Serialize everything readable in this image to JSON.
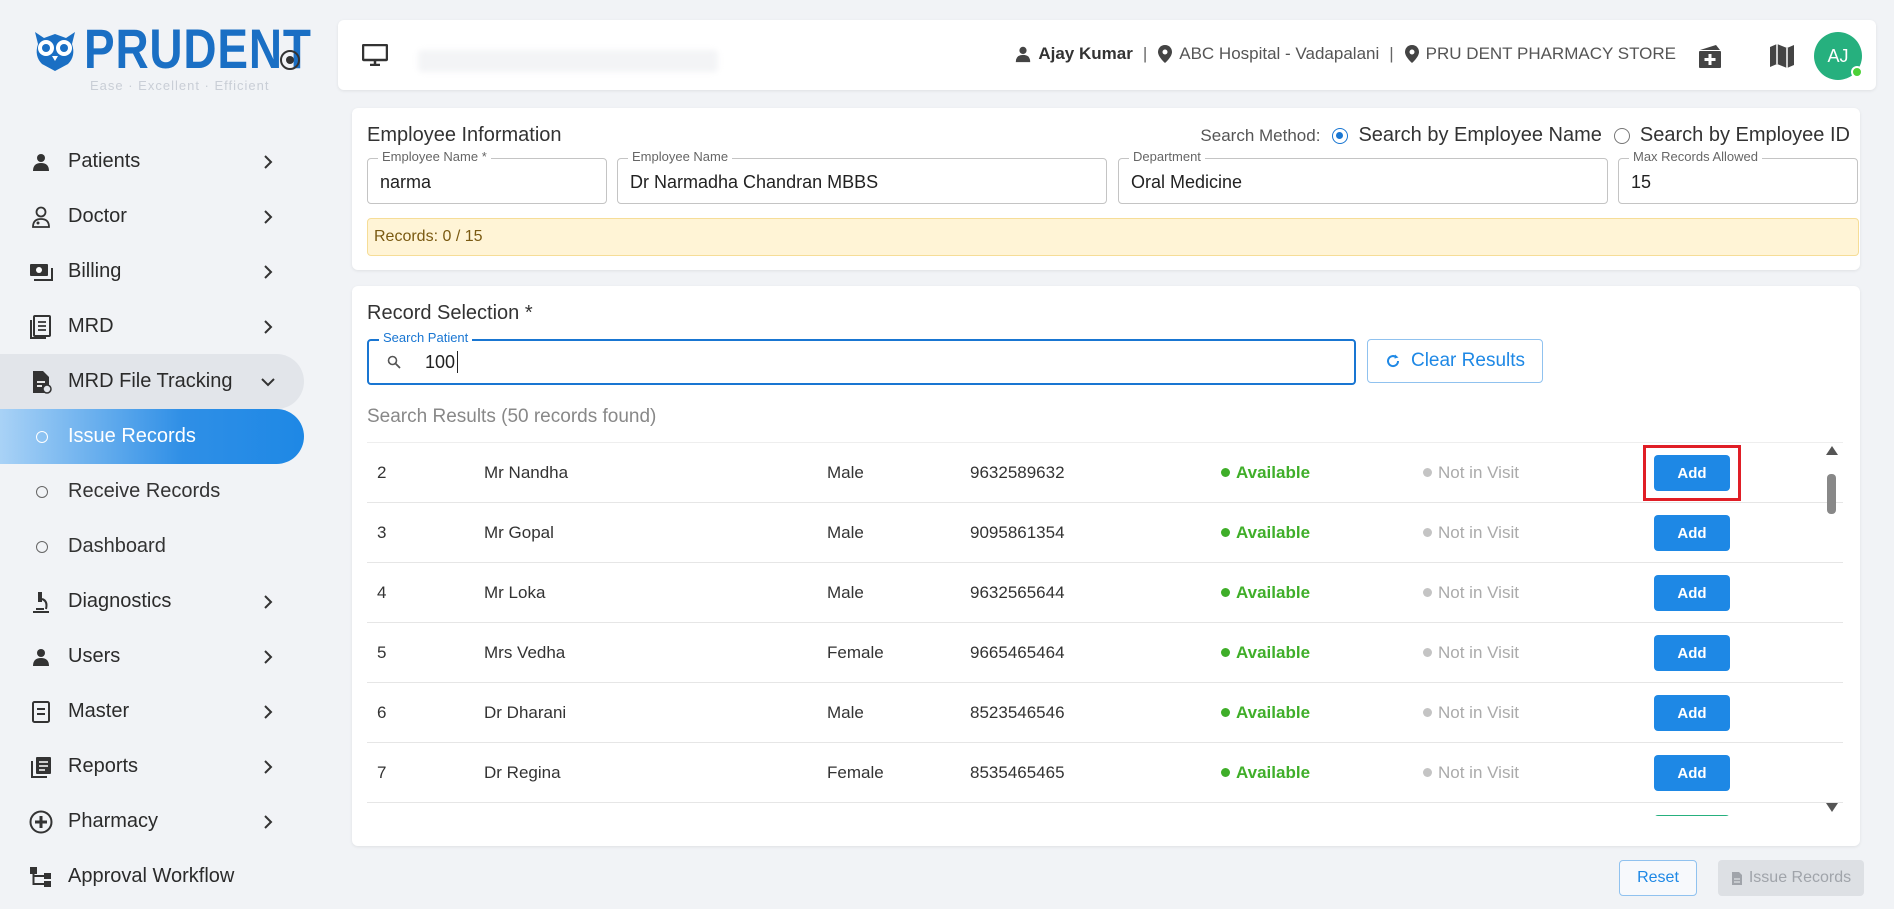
{
  "brand": {
    "name": "PRUDENT",
    "tagline": "Ease · Excellent · Efficient",
    "primary_color": "#1a6fc4"
  },
  "sidebar": {
    "items": [
      {
        "label": "Patients",
        "icon": "person-icon"
      },
      {
        "label": "Doctor",
        "icon": "doctor-icon"
      },
      {
        "label": "Billing",
        "icon": "billing-icon"
      },
      {
        "label": "MRD",
        "icon": "document-icon"
      },
      {
        "label": "MRD File Tracking",
        "icon": "file-tracking-icon",
        "expanded": true,
        "children": [
          {
            "label": "Issue Records",
            "active": true
          },
          {
            "label": "Receive Records"
          },
          {
            "label": "Dashboard"
          }
        ]
      },
      {
        "label": "Diagnostics",
        "icon": "microscope-icon"
      },
      {
        "label": "Users",
        "icon": "person-icon"
      },
      {
        "label": "Master",
        "icon": "master-icon"
      },
      {
        "label": "Reports",
        "icon": "reports-icon"
      },
      {
        "label": "Pharmacy",
        "icon": "pharmacy-icon"
      },
      {
        "label": "Approval Workflow",
        "icon": "workflow-icon"
      }
    ]
  },
  "header": {
    "user": "Ajay Kumar",
    "hospital": "ABC Hospital - Vadapalani",
    "store": "PRU DENT PHARMACY STORE",
    "avatar_initials": "AJ",
    "avatar_color": "#26b07e"
  },
  "employee": {
    "title": "Employee Information",
    "search_method_label": "Search Method:",
    "search_options": [
      "Search by Employee Name",
      "Search by Employee ID"
    ],
    "selected_option": "Search by Employee Name",
    "fields": {
      "emp_name_input": {
        "label": "Employee Name *",
        "value": "narma"
      },
      "emp_name": {
        "label": "Employee Name",
        "value": "Dr Narmadha Chandran MBBS"
      },
      "department": {
        "label": "Department",
        "value": "Oral Medicine"
      },
      "max_records": {
        "label": "Max Records Allowed",
        "value": "15"
      }
    },
    "records_status": "Records: 0 / 15"
  },
  "record_selection": {
    "title": "Record Selection *",
    "search_label": "Search Patient",
    "search_value": "100",
    "clear_label": "Clear Results",
    "results_text": "Search Results (50 records found)",
    "add_label": "Add",
    "rows": [
      {
        "id": "2",
        "name": "Mr Nandha",
        "gender": "Male",
        "phone": "9632589632",
        "status": "Available",
        "visit": "Not in Visit"
      },
      {
        "id": "3",
        "name": "Mr Gopal",
        "gender": "Male",
        "phone": "9095861354",
        "status": "Available",
        "visit": "Not in Visit"
      },
      {
        "id": "4",
        "name": "Mr Loka",
        "gender": "Male",
        "phone": "9632565644",
        "status": "Available",
        "visit": "Not in Visit"
      },
      {
        "id": "5",
        "name": "Mrs Vedha",
        "gender": "Female",
        "phone": "9665465464",
        "status": "Available",
        "visit": "Not in Visit"
      },
      {
        "id": "6",
        "name": "Dr Dharani",
        "gender": "Male",
        "phone": "8523546546",
        "status": "Available",
        "visit": "Not in Visit"
      },
      {
        "id": "7",
        "name": "Dr Regina",
        "gender": "Female",
        "phone": "8535465465",
        "status": "Available",
        "visit": "Not in Visit"
      }
    ]
  },
  "footer": {
    "reset_label": "Reset",
    "issue_label": "Issue Records"
  }
}
